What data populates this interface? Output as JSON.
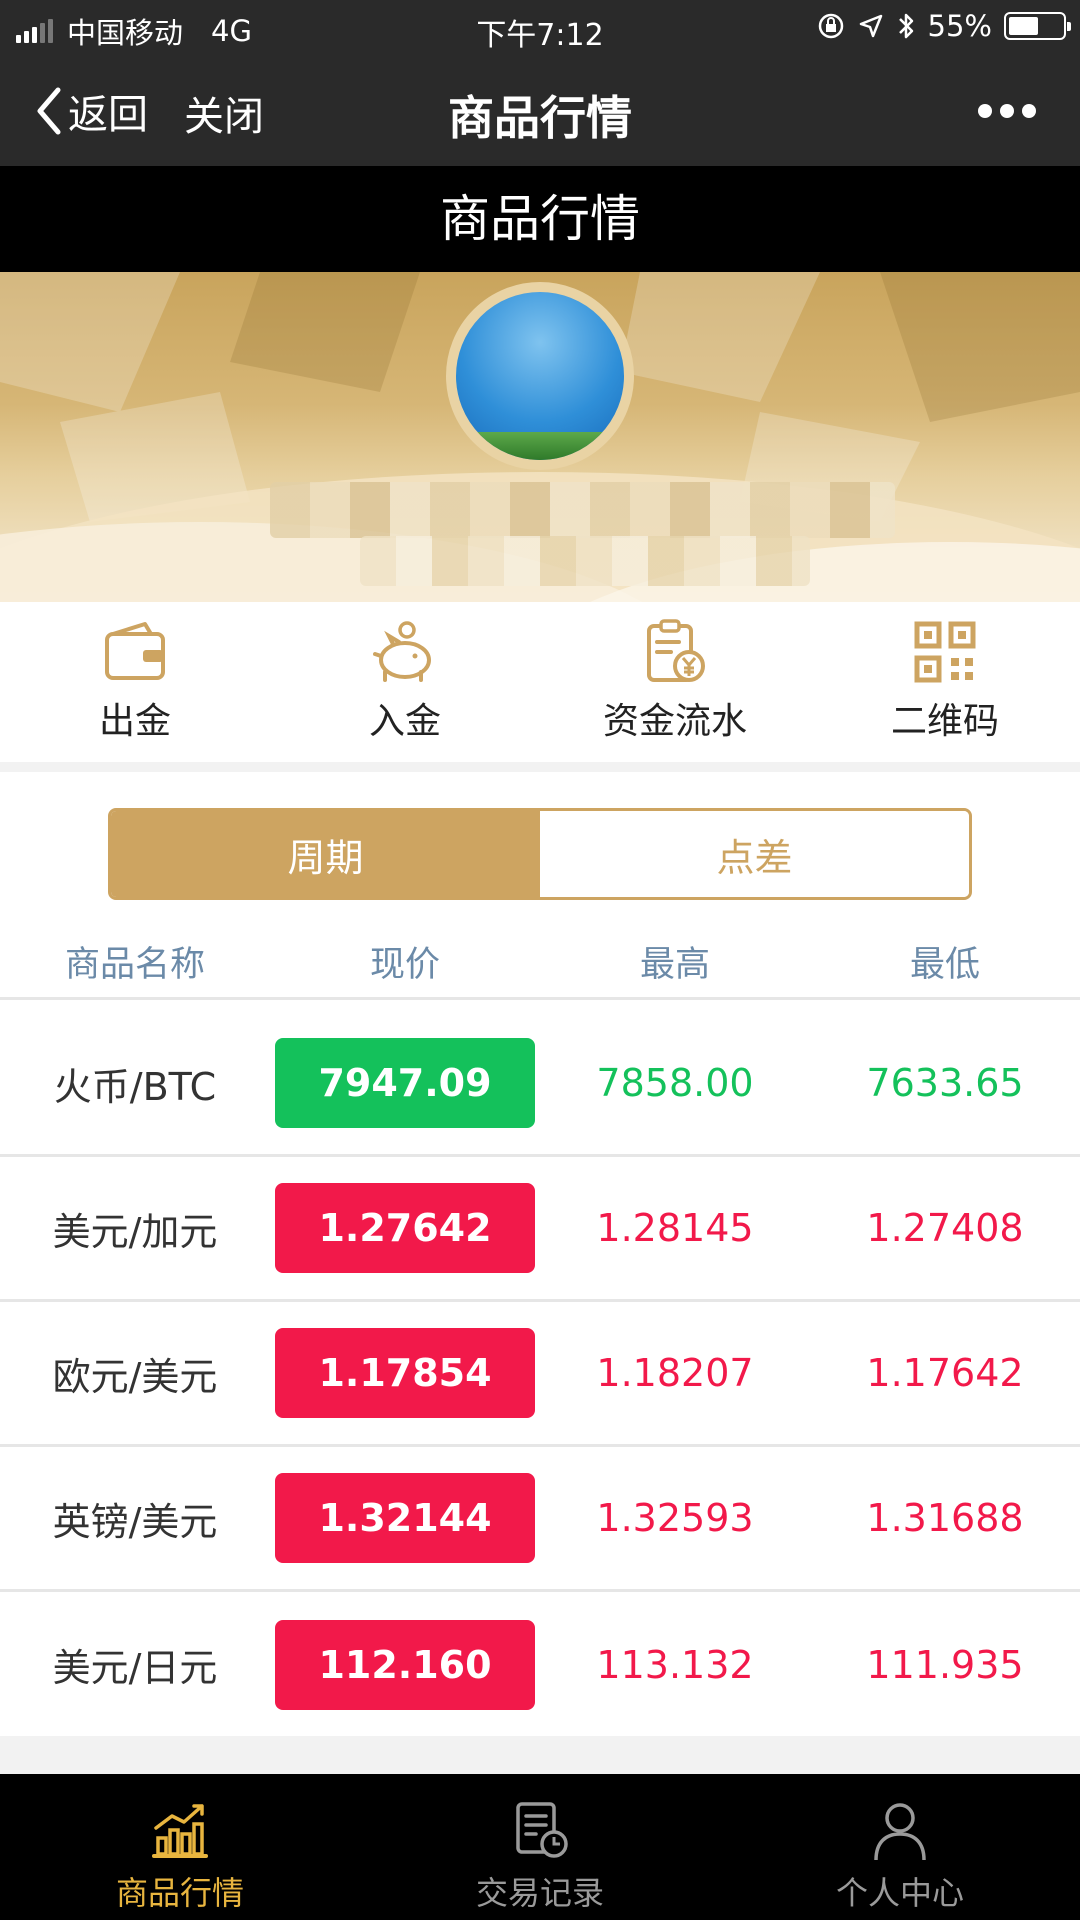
{
  "status_bar": {
    "carrier": "中国移动",
    "network": "4G",
    "time": "下午7:12",
    "battery": "55%",
    "battery_level": 0.55
  },
  "nav": {
    "back": "返回",
    "close": "关闭",
    "title": "商品行情"
  },
  "header": {
    "title": "商品行情"
  },
  "actions": [
    {
      "label": "出金",
      "icon": "wallet-icon"
    },
    {
      "label": "入金",
      "icon": "piggy-bank-icon"
    },
    {
      "label": "资金流水",
      "icon": "fund-flow-icon"
    },
    {
      "label": "二维码",
      "icon": "qr-code-icon"
    }
  ],
  "tabs": {
    "active": "周期",
    "inactive": "点差"
  },
  "table": {
    "headers": [
      "商品名称",
      "现价",
      "最高",
      "最低"
    ],
    "rows": [
      {
        "name": "火币/BTC",
        "price": "7947.09",
        "high": "7858.00",
        "low": "7633.65",
        "trend": "up"
      },
      {
        "name": "美元/加元",
        "price": "1.27642",
        "high": "1.28145",
        "low": "1.27408",
        "trend": "down"
      },
      {
        "name": "欧元/美元",
        "price": "1.17854",
        "high": "1.18207",
        "low": "1.17642",
        "trend": "down"
      },
      {
        "name": "英镑/美元",
        "price": "1.32144",
        "high": "1.32593",
        "low": "1.31688",
        "trend": "down"
      },
      {
        "name": "美元/日元",
        "price": "112.160",
        "high": "113.132",
        "low": "111.935",
        "trend": "down"
      }
    ]
  },
  "colors": {
    "gold": "#cda461",
    "green": "#14c15b",
    "red": "#f2194a",
    "tab_active": "#e8b53f",
    "tab_inactive": "#9a9a9a"
  },
  "tab_bar": [
    {
      "label": "商品行情",
      "icon": "chart-icon",
      "active": true
    },
    {
      "label": "交易记录",
      "icon": "record-icon",
      "active": false
    },
    {
      "label": "个人中心",
      "icon": "user-icon",
      "active": false
    }
  ]
}
